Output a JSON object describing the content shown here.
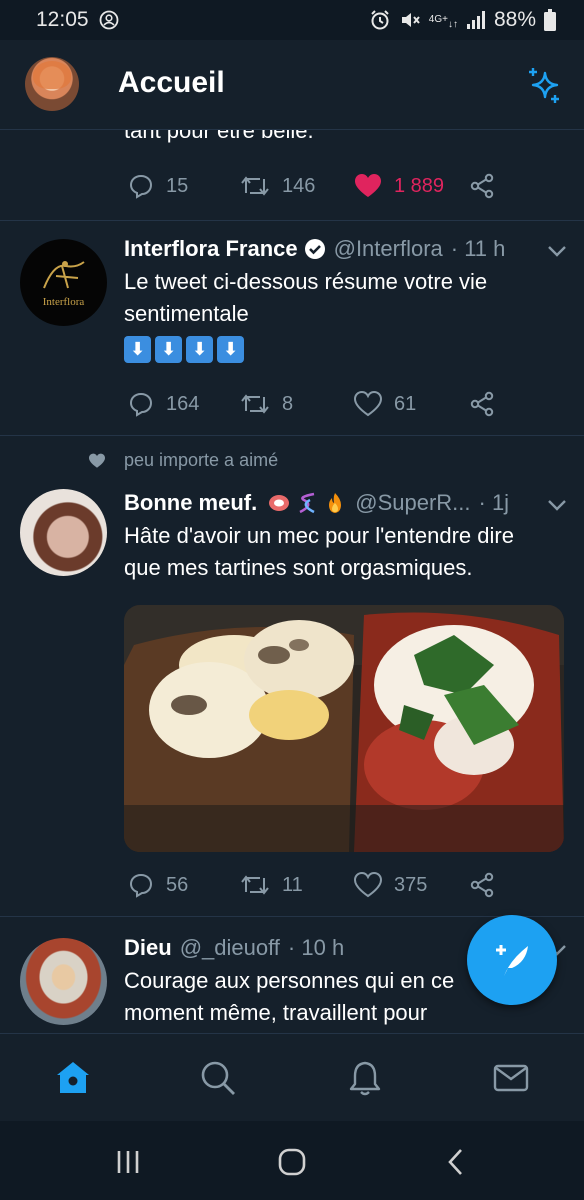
{
  "status_bar": {
    "time": "12:05",
    "network_top": "4G+",
    "battery": "88%"
  },
  "header": {
    "title": "Accueil"
  },
  "previous_tweet": {
    "text_tail": "tant pour être belle.",
    "replies": "15",
    "retweets": "146",
    "likes": "1 889"
  },
  "tweets": [
    {
      "name": "Interflora France",
      "verified": true,
      "handle": "@Interflora",
      "time": "· 11 h",
      "avatar_label": "Interflora",
      "text_lines": [
        "Le tweet ci-dessous résume votre vie",
        "sentimentale"
      ],
      "emoji_row": [
        "⬇",
        "⬇",
        "⬇",
        "⬇"
      ],
      "replies": "164",
      "retweets": "8",
      "likes": "61"
    },
    {
      "social_context": "peu importe a aimé",
      "name": "Bonne meuf.",
      "handle": "@SuperR...",
      "time": "· 1j",
      "text_lines": [
        "Hâte d'avoir un mec pour l'entendre dire",
        "que mes tartines sont orgasmiques."
      ],
      "replies": "56",
      "retweets": "11",
      "likes": "375"
    },
    {
      "name": "Dieu",
      "handle": "@_dieuoff",
      "time": "· 10 h",
      "text_lines": [
        "Courage aux personnes qui en ce",
        "moment même, travaillent pour"
      ]
    }
  ],
  "colors": {
    "background": "#15202b",
    "accent": "#1da1f2",
    "like": "#e0245e",
    "secondary_text": "#8899a6"
  },
  "icons": {
    "compose": "feather-plus-icon",
    "nav": [
      "home-icon",
      "search-icon",
      "bell-icon",
      "mail-icon"
    ]
  }
}
